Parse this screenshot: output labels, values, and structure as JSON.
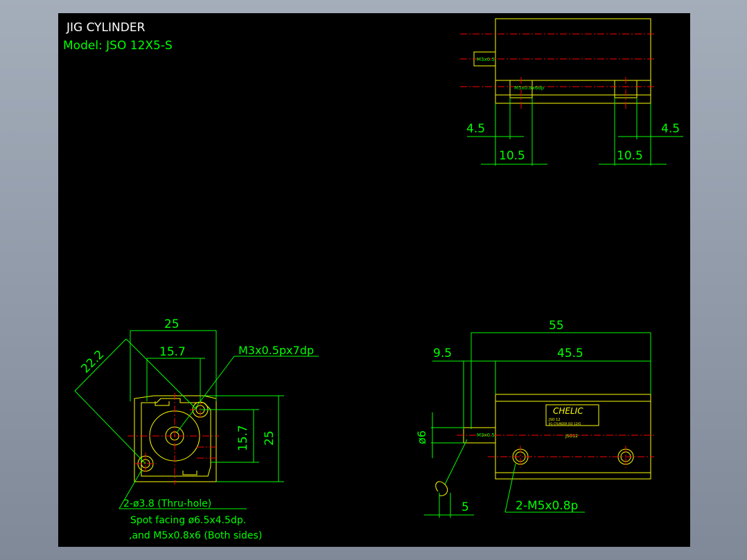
{
  "title": "JIG CYLINDER",
  "model": "Model: JSO 12X5-S",
  "top_view": {
    "port_label": "M3x0.5",
    "mount_label": "M5x0.8x6dp",
    "dim_left_small": "4.5",
    "dim_right_small": "4.5",
    "dim_left_wide": "10.5",
    "dim_right_wide": "10.5"
  },
  "front_view": {
    "dim_width": "25",
    "dim_offset": "15.7",
    "dim_diag": "22.2",
    "dim_vert_offset": "15.7",
    "dim_height": "25",
    "port_note": "M3x0.5px7dp",
    "hole_note": "2-ø3.8 (Thru-hole)",
    "spot_note": "Spot facing  ø6.5x4.5dp.",
    "thread_note": ",and M5x0.8x6 (Both sides)"
  },
  "side_view": {
    "dim_total": "55",
    "dim_rod": "9.5",
    "dim_body": "45.5",
    "dim_rod_dia": "ø6",
    "port_label": "M3x0.5",
    "rod_end": "5",
    "thread_note": "2-M5x0.8p",
    "brand": "CHELIC",
    "plate_line1": "JSO 12",
    "plate_line2": "JIG CYLINDER JSO 12X5",
    "series": "JSO12"
  },
  "colors": {
    "background": "#000000",
    "outline": "#ffff00",
    "dimension": "#00ff00",
    "centerline": "#ff0000",
    "text": "#ffffff"
  }
}
